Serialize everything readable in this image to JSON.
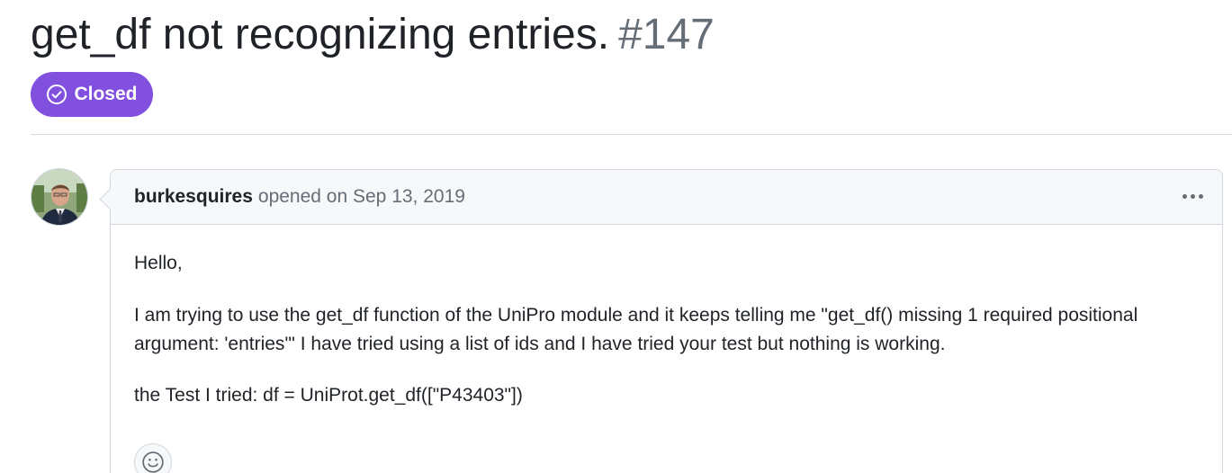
{
  "issue": {
    "title": "get_df not recognizing entries.",
    "number": "#147",
    "state_label": "Closed",
    "state_color": "#8250df"
  },
  "comment": {
    "author": "burkesquires",
    "meta": "opened on Sep 13, 2019",
    "body": {
      "greeting": "Hello,",
      "paragraph": "I am trying to use the get_df function of the UniPro module and it keeps telling me \"get_df() missing 1 required positional argument: 'entries'\" I have tried using a list of ids and I have tried your test but nothing is working.",
      "test_line": "the Test I tried: df = UniProt.get_df([\"P43403\"])"
    }
  },
  "icons": {
    "state": "check-circle-icon",
    "more": "kebab-horizontal-icon",
    "reaction": "smiley-icon",
    "avatar": "user-avatar"
  }
}
